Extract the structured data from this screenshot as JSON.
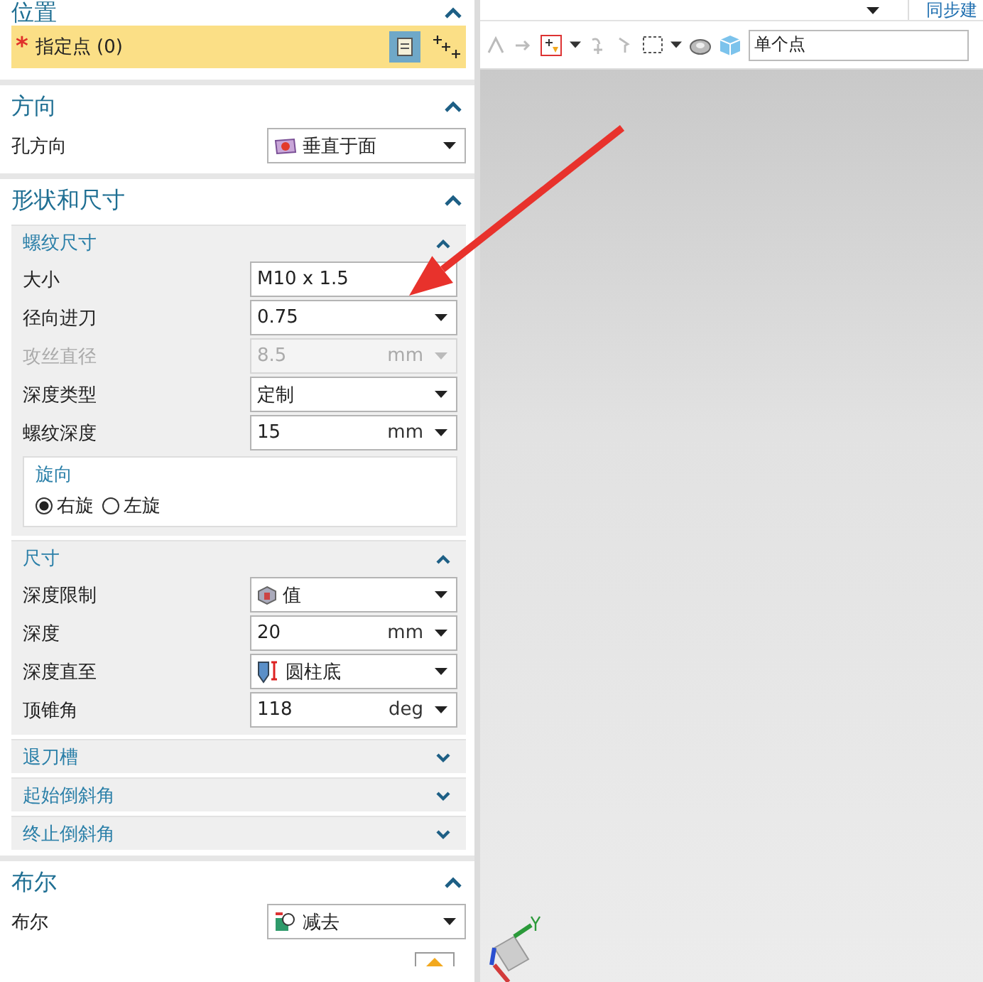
{
  "panel": {
    "sections": [
      {
        "kind": "point",
        "title": "位置",
        "expanded": true,
        "label": "指定点 (0)",
        "mark": "*"
      },
      {
        "kind": "fields",
        "title": "方向",
        "expanded": true,
        "rows": [
          {
            "label": "孔方向",
            "value": "垂直于面",
            "kind": "face",
            "disabled": false
          }
        ]
      },
      {
        "kind": "groups",
        "title": "形状和尺寸",
        "expanded": true,
        "groups": [
          {
            "title": "螺纹尺寸",
            "expanded": true,
            "rows": [
              {
                "label": "大小",
                "value": "M10 x 1.5",
                "disabled": false
              },
              {
                "label": "径向进刀",
                "value": "0.75",
                "disabled": false
              },
              {
                "label": "攻丝直径",
                "value": "8.5",
                "unit": "mm",
                "disabled": true
              },
              {
                "label": "深度类型",
                "value": "定制",
                "disabled": false
              },
              {
                "label": "螺纹深度",
                "value": "15",
                "unit": "mm",
                "disabled": false
              }
            ],
            "radio": {
              "title": "旋向",
              "options": [
                {
                  "label": "右旋",
                  "selected": true
                },
                {
                  "label": "左旋",
                  "selected": false
                }
              ]
            }
          },
          {
            "title": "尺寸",
            "expanded": true,
            "rows": [
              {
                "label": "深度限制",
                "value": "值",
                "kind": "cube",
                "disabled": false
              },
              {
                "label": "深度",
                "value": "20",
                "unit": "mm",
                "disabled": false
              },
              {
                "label": "深度直至",
                "value": "圆柱底",
                "kind": "drill",
                "disabled": false
              },
              {
                "label": "顶锥角",
                "value": "118",
                "unit": "deg",
                "disabled": false
              }
            ]
          },
          {
            "title": "退刀槽",
            "expanded": false
          },
          {
            "title": "起始倒斜角",
            "expanded": false
          },
          {
            "title": "终止倒斜角",
            "expanded": false
          }
        ]
      },
      {
        "kind": "fields",
        "title": "布尔",
        "expanded": true,
        "rows": [
          {
            "label": "布尔",
            "value": "减去",
            "kind": "subtract",
            "disabled": false
          }
        ]
      }
    ]
  },
  "toolbar": {
    "tab_label": "同步建",
    "filter": "单个点"
  }
}
